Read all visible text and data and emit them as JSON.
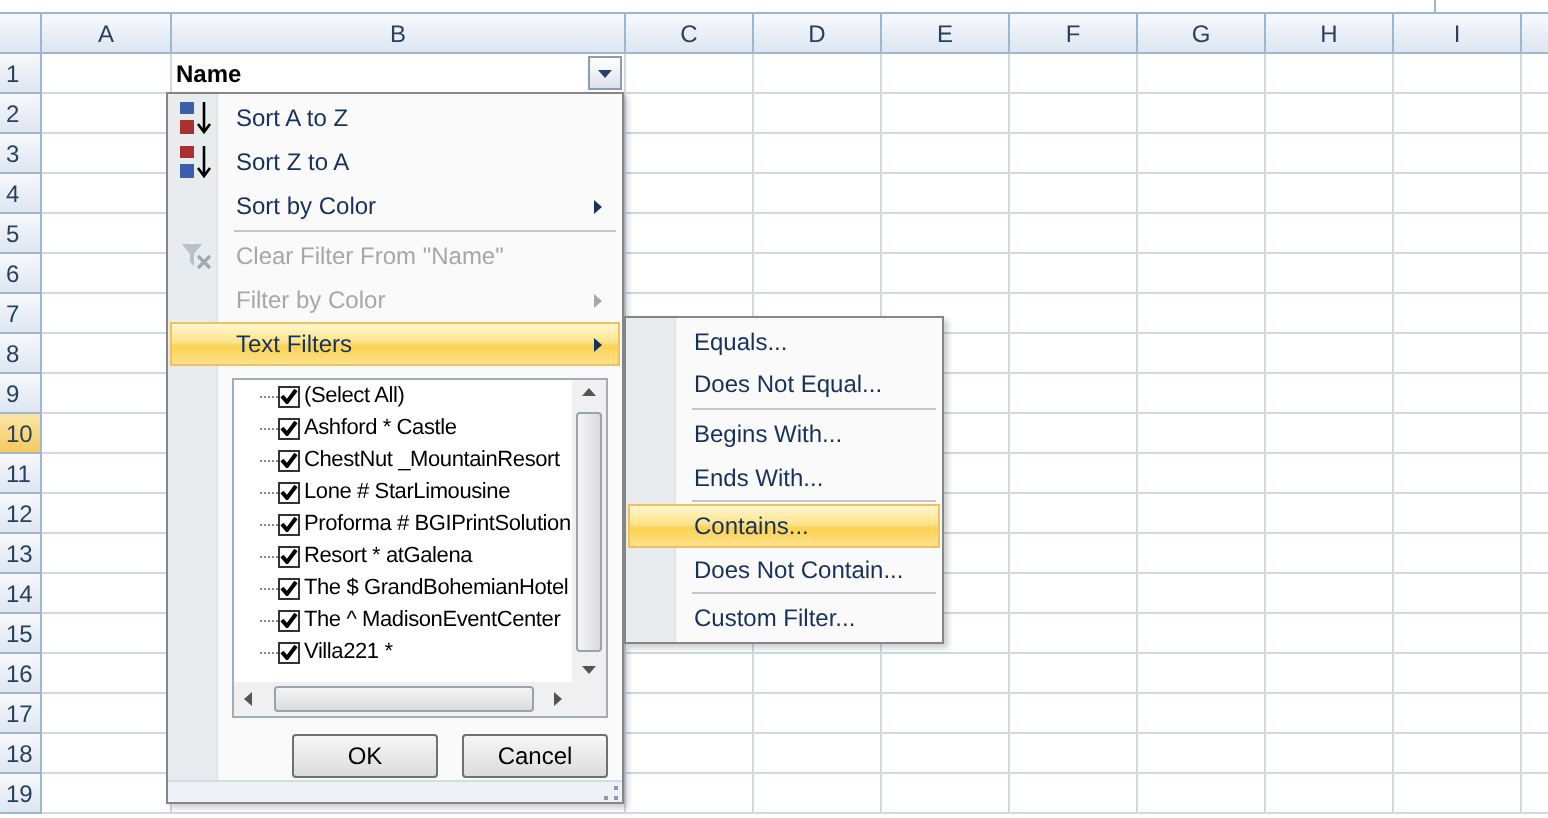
{
  "sheet": {
    "columns": [
      {
        "label": "A",
        "selected": false
      },
      {
        "label": "B",
        "selected": false
      },
      {
        "label": "C",
        "selected": false
      },
      {
        "label": "D",
        "selected": false
      },
      {
        "label": "E",
        "selected": false
      },
      {
        "label": "F",
        "selected": false
      },
      {
        "label": "G",
        "selected": false
      },
      {
        "label": "H",
        "selected": false
      },
      {
        "label": "I",
        "selected": false
      }
    ],
    "rows": [
      {
        "label": "1",
        "selected": false
      },
      {
        "label": "2",
        "selected": false
      },
      {
        "label": "3",
        "selected": false
      },
      {
        "label": "4",
        "selected": false
      },
      {
        "label": "5",
        "selected": false
      },
      {
        "label": "6",
        "selected": false
      },
      {
        "label": "7",
        "selected": false
      },
      {
        "label": "8",
        "selected": false
      },
      {
        "label": "9",
        "selected": false
      },
      {
        "label": "10",
        "selected": true
      },
      {
        "label": "11",
        "selected": false
      },
      {
        "label": "12",
        "selected": false
      },
      {
        "label": "13",
        "selected": false
      },
      {
        "label": "14",
        "selected": false
      },
      {
        "label": "15",
        "selected": false
      },
      {
        "label": "16",
        "selected": false
      },
      {
        "label": "17",
        "selected": false
      },
      {
        "label": "18",
        "selected": false
      },
      {
        "label": "19",
        "selected": false
      }
    ],
    "header_cell": {
      "text": "Name"
    }
  },
  "filter_menu": {
    "items": [
      {
        "kind": "sort-ascending",
        "label": "Sort A to Z",
        "disabled": false,
        "submenu": false,
        "selected": false
      },
      {
        "kind": "sort-descending",
        "label": "Sort Z to A",
        "disabled": false,
        "submenu": false,
        "selected": false
      },
      {
        "kind": "plain",
        "label": "Sort by Color",
        "disabled": false,
        "submenu": true,
        "selected": false
      },
      {
        "kind": "separator"
      },
      {
        "kind": "clear-filter",
        "label": "Clear Filter From \"Name\"",
        "disabled": true,
        "submenu": false,
        "selected": false
      },
      {
        "kind": "plain",
        "label": "Filter by Color",
        "disabled": true,
        "submenu": true,
        "selected": false
      },
      {
        "kind": "plain",
        "label": "Text Filters",
        "disabled": false,
        "submenu": true,
        "selected": true
      }
    ],
    "values": [
      {
        "label": "(Select All)",
        "checked": true
      },
      {
        "label": "Ashford * Castle",
        "checked": true
      },
      {
        "label": "ChestNut _MountainResort",
        "checked": true
      },
      {
        "label": "Lone # StarLimousine",
        "checked": true
      },
      {
        "label": "Proforma # BGIPrintSolution",
        "checked": true
      },
      {
        "label": "Resort * atGalena",
        "checked": true
      },
      {
        "label": "The $ GrandBohemianHotel",
        "checked": true
      },
      {
        "label": "The ^ MadisonEventCenter",
        "checked": true
      },
      {
        "label": "Villa221 *",
        "checked": true
      }
    ],
    "buttons": [
      "OK",
      "Cancel"
    ]
  },
  "text_filters_menu": {
    "items": [
      {
        "kind": "item",
        "label": "Equals...",
        "selected": false
      },
      {
        "kind": "item",
        "label": "Does Not Equal...",
        "selected": false
      },
      {
        "kind": "separator"
      },
      {
        "kind": "item",
        "label": "Begins With...",
        "selected": false
      },
      {
        "kind": "item",
        "label": "Ends With...",
        "selected": false
      },
      {
        "kind": "separator"
      },
      {
        "kind": "item",
        "label": "Contains...",
        "selected": true
      },
      {
        "kind": "item",
        "label": "Does Not Contain...",
        "selected": false
      },
      {
        "kind": "separator"
      },
      {
        "kind": "item",
        "label": "Custom Filter...",
        "selected": false
      }
    ]
  }
}
